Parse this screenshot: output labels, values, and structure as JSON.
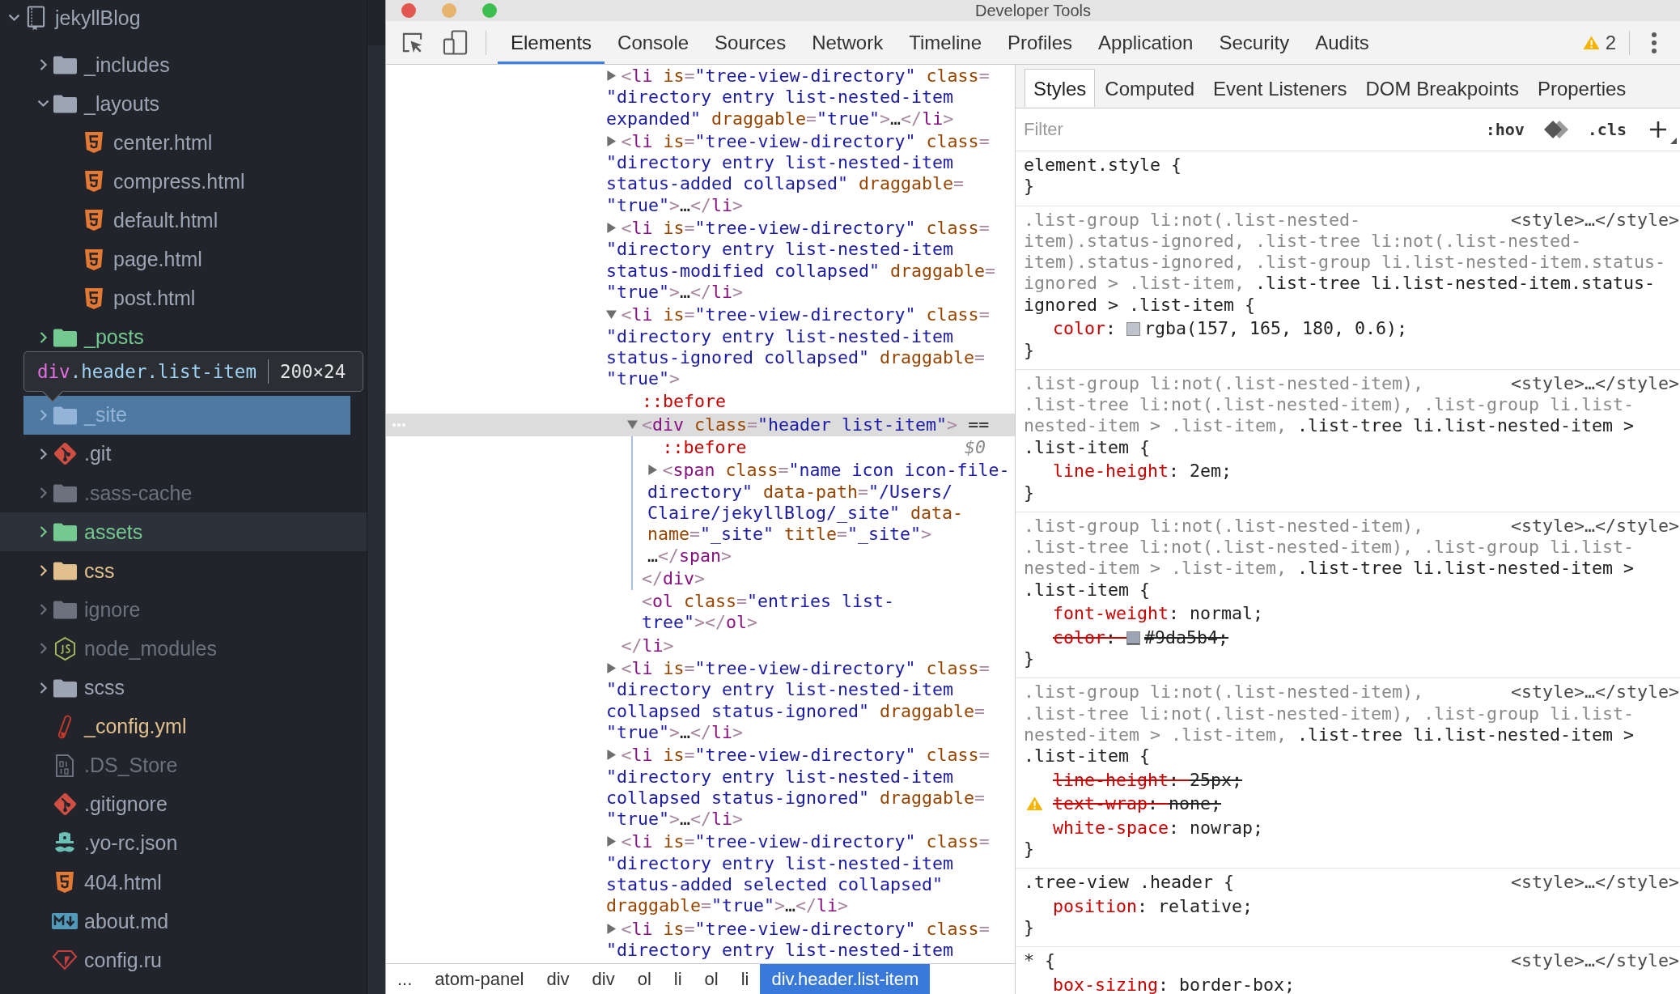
{
  "tree_view": {
    "root": {
      "name": "jekyllBlog",
      "kind": "repo",
      "color": "#9da5b4",
      "expanded": true,
      "selected": false,
      "inspected": false,
      "children": [
        {
          "name": "_includes",
          "kind": "folder",
          "color": "#9da5b4",
          "expanded": false,
          "selected": false,
          "inspected": false
        },
        {
          "name": "_layouts",
          "kind": "folder",
          "color": "#9da5b4",
          "expanded": true,
          "selected": false,
          "inspected": false,
          "children": [
            {
              "name": "center.html",
              "kind": "html",
              "color": "#9da5b4",
              "selected": false,
              "inspected": false
            },
            {
              "name": "compress.html",
              "kind": "html",
              "color": "#9da5b4",
              "selected": false,
              "inspected": false
            },
            {
              "name": "default.html",
              "kind": "html",
              "color": "#9da5b4",
              "selected": false,
              "inspected": false
            },
            {
              "name": "page.html",
              "kind": "html",
              "color": "#9da5b4",
              "selected": false,
              "inspected": false
            },
            {
              "name": "post.html",
              "kind": "html",
              "color": "#9da5b4",
              "selected": false,
              "inspected": false
            }
          ]
        },
        {
          "name": "_posts",
          "kind": "folder",
          "color": "#73c990",
          "expanded": false,
          "selected": false,
          "inspected": false
        },
        {
          "selected": false,
          "inspected": false
        },
        {
          "name": "_site",
          "kind": "folder",
          "color": "#93b4d6",
          "expanded": false,
          "selected": false,
          "inspected": true
        },
        {
          "name": ".git",
          "kind": "git",
          "color": "#9da5b4",
          "expanded": false,
          "selected": false,
          "inspected": false
        },
        {
          "name": ".sass-cache",
          "kind": "folder",
          "color": "#6b727d",
          "expanded": false,
          "selected": false,
          "inspected": false
        },
        {
          "name": "assets",
          "kind": "folder",
          "color": "#73c990",
          "expanded": false,
          "selected": true,
          "inspected": false
        },
        {
          "name": "css",
          "kind": "folder",
          "color": "#e2c08d",
          "expanded": false,
          "selected": false,
          "inspected": false
        },
        {
          "name": "ignore",
          "kind": "folder",
          "color": "#6b727d",
          "expanded": false,
          "selected": false,
          "inspected": false
        },
        {
          "name": "node_modules",
          "kind": "nodejs",
          "color": "#6b727d",
          "expanded": false,
          "selected": false,
          "inspected": false
        },
        {
          "name": "scss",
          "kind": "folder",
          "color": "#9da5b4",
          "expanded": false,
          "selected": false,
          "inspected": false
        },
        {
          "name": "_config.yml",
          "kind": "yaml",
          "color": "#e2c08d",
          "selected": false,
          "inspected": false
        },
        {
          "name": ".DS_Store",
          "kind": "binary",
          "color": "#6b727d",
          "selected": false,
          "inspected": false
        },
        {
          "name": ".gitignore",
          "kind": "git",
          "color": "#9da5b4",
          "selected": false,
          "inspected": false
        },
        {
          "name": ".yo-rc.json",
          "kind": "yeoman",
          "color": "#9da5b4",
          "selected": false,
          "inspected": false
        },
        {
          "name": "404.html",
          "kind": "html",
          "color": "#9da5b4",
          "selected": false,
          "inspected": false
        },
        {
          "name": "about.md",
          "kind": "markdown",
          "color": "#9da5b4",
          "selected": false,
          "inspected": false
        },
        {
          "name": "config.ru",
          "kind": "ruby",
          "color": "#9da5b4",
          "selected": false,
          "inspected": false
        }
      ]
    },
    "inspect_tooltip": {
      "tag": "div",
      "classes": ".header.list-item",
      "size": "200×24"
    }
  },
  "devtools": {
    "title": "Developer Tools",
    "tabs": [
      {
        "label": "Elements",
        "selected": true
      },
      {
        "label": "Console",
        "selected": false
      },
      {
        "label": "Sources",
        "selected": false
      },
      {
        "label": "Network",
        "selected": false
      },
      {
        "label": "Timeline",
        "selected": false
      },
      {
        "label": "Profiles",
        "selected": false
      },
      {
        "label": "Application",
        "selected": false
      },
      {
        "label": "Security",
        "selected": false
      },
      {
        "label": "Audits",
        "selected": false
      }
    ],
    "warnings": "2"
  },
  "elements_panel": {
    "dom_tree": [
      {
        "lines": [
          "<li is=\"tree-view-directory\" class=",
          "\"directory entry list-nested-item",
          "expanded\" draggable=\"true\">…</li>"
        ],
        "expanded": false,
        "selected": false
      },
      {
        "lines": [
          "<li is=\"tree-view-directory\" class=",
          "\"directory entry list-nested-item",
          "status-added collapsed\" draggable=",
          "\"true\">…</li>"
        ],
        "expanded": false,
        "selected": false
      },
      {
        "lines": [
          "<li is=\"tree-view-directory\" class=",
          "\"directory entry list-nested-item",
          "status-modified collapsed\" draggable=",
          "\"true\">…</li>"
        ],
        "expanded": false,
        "selected": false
      },
      {
        "lines": [
          "<li is=\"tree-view-directory\" class=",
          "\"directory entry list-nested-item",
          "status-ignored collapsed\" draggable=",
          "\"true\">"
        ],
        "expanded": true,
        "selected": false,
        "close": "</li>",
        "children": [
          {
            "lines": [
              "::before"
            ],
            "selected": false
          },
          {
            "lines": [
              "<div class=\"header list-item\"> =="
            ],
            "expanded": true,
            "selected": true,
            "ref": "$0",
            "close": "</div>",
            "children": [
              {
                "lines": [
                  "::before"
                ],
                "selected": false
              },
              {
                "lines": [
                  "<span class=\"name icon icon-file-",
                  "directory\" data-path=\"/Users/",
                  "Claire/jekyllBlog/_site\" data-",
                  "name=\"_site\" title=\"_site\">",
                  "…</span>"
                ],
                "expanded": false,
                "selected": false
              }
            ]
          },
          {
            "lines": [
              "<ol class=\"entries list-",
              "tree\"></ol>"
            ],
            "selected": false
          }
        ]
      },
      {
        "lines": [
          "<li is=\"tree-view-directory\" class=",
          "\"directory entry list-nested-item",
          "collapsed status-ignored\" draggable=",
          "\"true\">…</li>"
        ],
        "expanded": false,
        "selected": false
      },
      {
        "lines": [
          "<li is=\"tree-view-directory\" class=",
          "\"directory entry list-nested-item",
          "collapsed status-ignored\" draggable=",
          "\"true\">…</li>"
        ],
        "expanded": false,
        "selected": false
      },
      {
        "lines": [
          "<li is=\"tree-view-directory\" class=",
          "\"directory entry list-nested-item",
          "status-added selected collapsed\"",
          "draggable=\"true\">…</li>"
        ],
        "expanded": false,
        "selected": false
      },
      {
        "lines": [
          "<li is=\"tree-view-directory\" class=",
          "\"directory entry list-nested-item"
        ],
        "expanded": false,
        "selected": false
      }
    ],
    "breadcrumbs": [
      {
        "label": "...",
        "selected": false
      },
      {
        "label": "atom-panel",
        "selected": false
      },
      {
        "label": "div",
        "selected": false
      },
      {
        "label": "div",
        "selected": false
      },
      {
        "label": "ol",
        "selected": false
      },
      {
        "label": "li",
        "selected": false
      },
      {
        "label": "ol",
        "selected": false
      },
      {
        "label": "li",
        "selected": false
      },
      {
        "label": "div.header.list-item",
        "selected": true
      }
    ]
  },
  "styles_panel": {
    "tabs": [
      {
        "label": "Styles",
        "selected": true
      },
      {
        "label": "Computed",
        "selected": false
      },
      {
        "label": "Event Listeners",
        "selected": false
      },
      {
        "label": "DOM Breakpoints",
        "selected": false
      },
      {
        "label": "Properties",
        "selected": false
      }
    ],
    "filter": {
      "placeholder": "Filter"
    },
    "state_toggle": ":hov",
    "class_toggle": ".cls",
    "rules": [
      {
        "selector": [
          {
            "text": "element.style {",
            "matched": true
          }
        ],
        "close": "}"
      },
      {
        "source": "<style>…</style>",
        "selector": [
          {
            "text": ".list-group li:not(.list-nested-\nitem).status-ignored, .list-tree li:not(.list-nested-\nitem).status-ignored, .list-group li.list-nested-item.status-\nignored > .list-item, ",
            "matched": false
          },
          {
            "text": ".list-tree li.list-nested-item.status-\nignored > .list-item {",
            "matched": true
          }
        ],
        "properties": [
          {
            "text": "color: rgba(157, 165, 180, 0.6);",
            "color": "#bfc3cb",
            "overridden": false,
            "warning": false
          }
        ],
        "close": "}"
      },
      {
        "source": "<style>…</style>",
        "selector": [
          {
            "text": ".list-group li:not(.list-nested-item),\n.list-tree li:not(.list-nested-item), .list-group li.list-\nnested-item > .list-item, ",
            "matched": false
          },
          {
            "text": ".list-tree li.list-nested-item >\n.list-item {",
            "matched": true
          }
        ],
        "properties": [
          {
            "text": "line-height: 2em;",
            "overridden": false,
            "warning": false
          }
        ],
        "close": "}"
      },
      {
        "source": "<style>…</style>",
        "selector": [
          {
            "text": ".list-group li:not(.list-nested-item),\n.list-tree li:not(.list-nested-item), .list-group li.list-\nnested-item > .list-item, ",
            "matched": false
          },
          {
            "text": ".list-tree li.list-nested-item >\n.list-item {",
            "matched": true
          }
        ],
        "properties": [
          {
            "text": "font-weight: normal;",
            "overridden": false,
            "warning": false
          },
          {
            "text": "color: #9da5b4;",
            "color": "#9da5b4",
            "overridden": true,
            "warning": false
          }
        ],
        "close": "}"
      },
      {
        "source": "<style>…</style>",
        "selector": [
          {
            "text": ".list-group li:not(.list-nested-item),\n.list-tree li:not(.list-nested-item), .list-group li.list-\nnested-item > .list-item, ",
            "matched": false
          },
          {
            "text": ".list-tree li.list-nested-item >\n.list-item {",
            "matched": true
          }
        ],
        "properties": [
          {
            "text": "line-height: 25px;",
            "overridden": true,
            "warning": false
          },
          {
            "text": "text-wrap: none;",
            "overridden": true,
            "warning": true
          },
          {
            "text": "white-space: nowrap;",
            "overridden": false,
            "warning": false
          }
        ],
        "close": "}"
      },
      {
        "source": "<style>…</style>",
        "selector": [
          {
            "text": ".tree-view .header {",
            "matched": true
          }
        ],
        "properties": [
          {
            "text": "position: relative;",
            "overridden": false,
            "warning": false
          }
        ],
        "close": "}"
      },
      {
        "source": "<style>…</style>",
        "selector": [
          {
            "text": "* {",
            "matched": true
          }
        ],
        "properties": [
          {
            "text": "box-sizing: border-box;",
            "overridden": false,
            "warning": false
          }
        ]
      }
    ]
  }
}
